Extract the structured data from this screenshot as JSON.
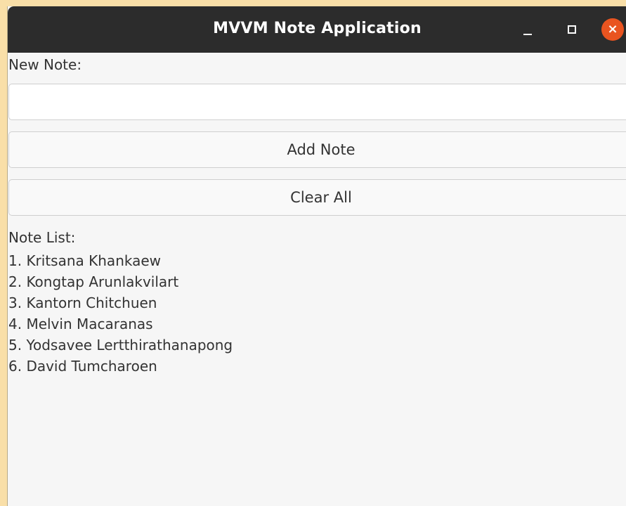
{
  "window": {
    "title": "MVVM Note Application",
    "controls": {
      "minimize_icon": "minimize-icon",
      "maximize_icon": "maximize-icon",
      "close_icon": "close-icon",
      "close_glyph": "×",
      "close_color": "#e95420"
    }
  },
  "form": {
    "new_note_label": "New Note:",
    "input_value": "",
    "input_placeholder": "",
    "add_button_label": "Add Note",
    "clear_button_label": "Clear All"
  },
  "notes": {
    "label": "Note List:",
    "items": [
      "1. Kritsana Khankaew",
      "2. Kongtap Arunlakvilart",
      "3. Kantorn Chitchuen",
      "4. Melvin Macaranas",
      "5. Yodsavee Lertthirathanapong",
      "6. David Tumcharoen"
    ]
  },
  "colors": {
    "titlebar": "#2c2c2c",
    "desktop": "#f9dfa8",
    "window_bg": "#f6f6f6",
    "accent_close": "#e95420"
  }
}
